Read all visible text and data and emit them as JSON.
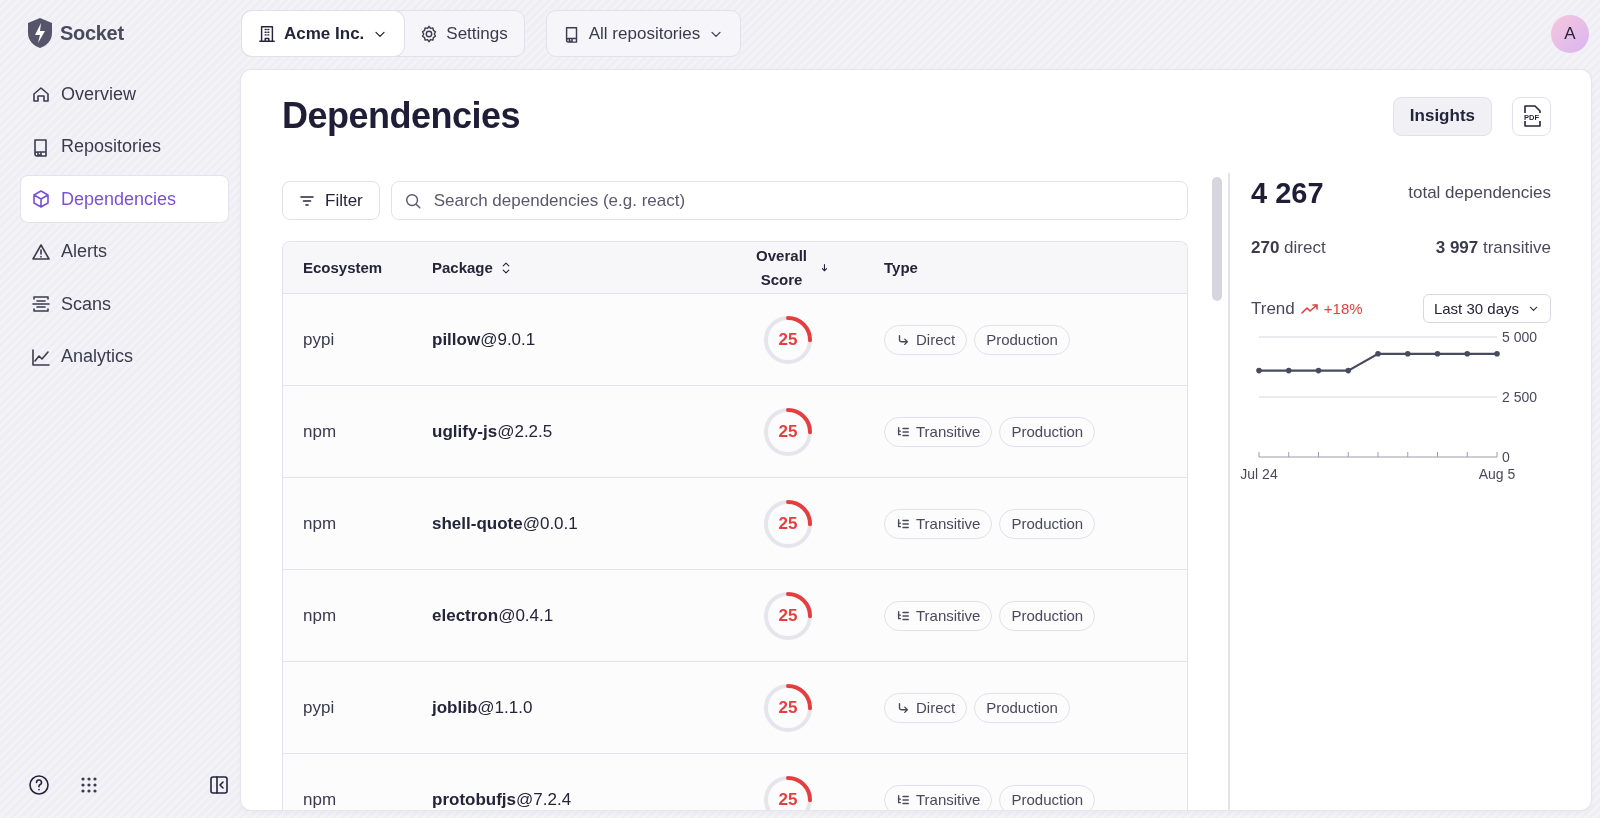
{
  "brand": {
    "name": "Socket"
  },
  "org_switcher": {
    "label": "Acme Inc."
  },
  "settings_button": {
    "label": "Settings"
  },
  "repo_switcher": {
    "label": "All repositories"
  },
  "avatar": {
    "initial": "A"
  },
  "sidebar": {
    "items": [
      {
        "label": "Overview",
        "selected": false
      },
      {
        "label": "Repositories",
        "selected": false
      },
      {
        "label": "Dependencies",
        "selected": true
      },
      {
        "label": "Alerts",
        "selected": false
      },
      {
        "label": "Scans",
        "selected": false
      },
      {
        "label": "Analytics",
        "selected": false
      }
    ]
  },
  "page": {
    "title": "Dependencies",
    "insights_button": "Insights",
    "pdf_button": "PDF"
  },
  "filter_button": {
    "label": "Filter"
  },
  "search": {
    "placeholder": "Search dependencies (e.g. react)"
  },
  "table": {
    "columns": [
      {
        "label": "Ecosystem"
      },
      {
        "label": "Package"
      },
      {
        "label": "Overall Score"
      },
      {
        "label": "Type"
      }
    ],
    "rows": [
      {
        "ecosystem": "pypi",
        "package": "**pillow**@9.0.1",
        "score": {
          "value": "25",
          "level": 0.25
        },
        "type": {
          "kind": "direct",
          "label": "Direct"
        },
        "environment": "Production"
      },
      {
        "ecosystem": "npm",
        "package": "**uglify-js**@2.2.5",
        "score": {
          "value": "25",
          "level": 0.25
        },
        "type": {
          "kind": "transitive",
          "label": "Transitive"
        },
        "environment": "Production"
      },
      {
        "ecosystem": "npm",
        "package": "**shell-quote**@0.0.1",
        "score": {
          "value": "25",
          "level": 0.25
        },
        "type": {
          "kind": "transitive",
          "label": "Transitive"
        },
        "environment": "Production"
      },
      {
        "ecosystem": "npm",
        "package": "**electron**@0.4.1",
        "score": {
          "value": "25",
          "level": 0.25
        },
        "type": {
          "kind": "transitive",
          "label": "Transitive"
        },
        "environment": "Production"
      },
      {
        "ecosystem": "pypi",
        "package": "**joblib**@1.1.0",
        "score": {
          "value": "25",
          "level": 0.25
        },
        "type": {
          "kind": "direct",
          "label": "Direct"
        },
        "environment": "Production"
      },
      {
        "ecosystem": "npm",
        "package": "**protobufjs**@7.2.4",
        "score": {
          "value": "25",
          "level": 0.25
        },
        "type": {
          "kind": "transitive",
          "label": "Transitive"
        },
        "environment": "Production"
      }
    ]
  },
  "stats": {
    "total": "4 267",
    "total_label": "total dependencies",
    "direct": "**270** direct",
    "transitive": "**3 997** transitive",
    "trend": {
      "label": "Trend",
      "change": "+18%"
    },
    "range": "Last 30 days",
    "chart_data": {
      "type": "line",
      "categories": [
        "Jul 24",
        null,
        null,
        null,
        null,
        null,
        null,
        null,
        "Aug 5"
      ],
      "series": [
        {
          "color": "#4a4a5e",
          "values": [
            3600,
            3600,
            3600,
            3600,
            4300,
            4300,
            4300,
            4300,
            4300
          ]
        }
      ],
      "ylim": [
        0,
        5000
      ],
      "yticks": [
        {
          "value": 0,
          "label": "0"
        },
        {
          "value": 2500,
          "label": "2 500"
        },
        {
          "value": 5000,
          "label": "5 000"
        }
      ]
    }
  }
}
